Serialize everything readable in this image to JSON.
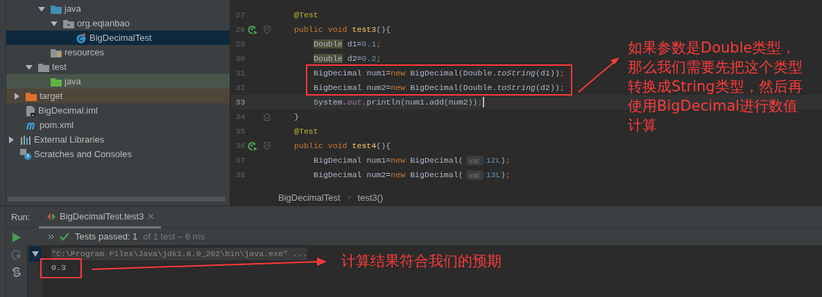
{
  "project_tree": {
    "items": [
      {
        "children": [
          {
            "children": [
              {
                "children": [
                  {
                    "label": "java",
                    "kind": "source-folder",
                    "expanded": true,
                    "selected": false,
                    "children": [
                      {
                        "label": "org.eqianbao",
                        "kind": "package",
                        "expanded": true,
                        "selected": false,
                        "children": [
                          {
                            "label": "BigDecimalTest",
                            "kind": "class",
                            "selected": true
                          }
                        ]
                      }
                    ]
                  },
                  {
                    "label": "resources",
                    "kind": "resources-folder",
                    "selected": false
                  }
                ]
              },
              {
                "label": "test",
                "kind": "folder",
                "expanded": true,
                "selected": false,
                "children": [
                  {
                    "label": "java",
                    "kind": "test-folder",
                    "selected": false
                  }
                ]
              }
            ]
          },
          {
            "label": "target",
            "kind": "excluded-folder",
            "expanded": false,
            "selected": false
          },
          {
            "label": "BigDecimal.iml",
            "kind": "module-file",
            "selected": false
          },
          {
            "label": "pom.xml",
            "kind": "maven",
            "selected": false
          }
        ]
      },
      {
        "label": "External Libraries",
        "kind": "libraries",
        "expanded": false,
        "selected": false
      },
      {
        "label": "Scratches and Consoles",
        "kind": "scratches",
        "selected": false
      }
    ]
  },
  "editor": {
    "lines": [
      {
        "number": "27",
        "kind": "member",
        "current": false,
        "runnable": false,
        "fold_start": false,
        "fold_end": false,
        "tokens": [
          {
            "kind": "annotation",
            "text": "@Test"
          }
        ]
      },
      {
        "number": "28",
        "kind": "member",
        "current": false,
        "runnable": true,
        "fold_start": true,
        "fold_end": false,
        "tokens": [
          {
            "kind": "keyword",
            "text": "public void "
          },
          {
            "kind": "method",
            "text": "test3"
          },
          {
            "kind": "plain",
            "text": "(){"
          }
        ]
      },
      {
        "number": "29",
        "kind": "statement",
        "current": false,
        "runnable": false,
        "fold_start": false,
        "fold_end": false,
        "tokens": [
          {
            "kind": "warning",
            "text": "Double"
          },
          {
            "kind": "plain",
            "text": " d1="
          },
          {
            "kind": "number",
            "text": "0.1"
          },
          {
            "kind": "keyword",
            "text": ";"
          }
        ]
      },
      {
        "number": "30",
        "kind": "statement",
        "current": false,
        "runnable": false,
        "fold_start": false,
        "fold_end": false,
        "tokens": [
          {
            "kind": "warning",
            "text": "Double"
          },
          {
            "kind": "plain",
            "text": " d2="
          },
          {
            "kind": "number",
            "text": "0.2"
          },
          {
            "kind": "keyword",
            "text": ";"
          }
        ]
      },
      {
        "number": "31",
        "kind": "statement",
        "current": false,
        "runnable": false,
        "fold_start": false,
        "fold_end": false,
        "tokens": [
          {
            "kind": "plain",
            "text": "BigDecimal num1="
          },
          {
            "kind": "keyword",
            "text": "new"
          },
          {
            "kind": "plain",
            "text": " BigDecimal(Double."
          },
          {
            "kind": "static",
            "text": "toString"
          },
          {
            "kind": "plain",
            "text": "(d1))"
          },
          {
            "kind": "keyword",
            "text": ";"
          }
        ]
      },
      {
        "number": "32",
        "kind": "statement",
        "current": false,
        "runnable": false,
        "fold_start": false,
        "fold_end": false,
        "tokens": [
          {
            "kind": "plain",
            "text": "BigDecimal num2="
          },
          {
            "kind": "keyword",
            "text": "new"
          },
          {
            "kind": "plain",
            "text": " BigDecimal(Double."
          },
          {
            "kind": "static",
            "text": "toString"
          },
          {
            "kind": "plain",
            "text": "(d2))"
          },
          {
            "kind": "keyword",
            "text": ";"
          }
        ]
      },
      {
        "number": "33",
        "kind": "statement",
        "current": true,
        "runnable": false,
        "fold_start": false,
        "fold_end": false,
        "tokens": [
          {
            "kind": "plain",
            "text": "System."
          },
          {
            "kind": "field",
            "text": "out"
          },
          {
            "kind": "plain",
            "text": ".println(num1.add(num2))"
          },
          {
            "kind": "keyword",
            "text": ";"
          }
        ]
      },
      {
        "number": "34",
        "kind": "member",
        "current": false,
        "runnable": false,
        "fold_start": false,
        "fold_end": true,
        "tokens": [
          {
            "kind": "plain",
            "text": "}"
          }
        ]
      },
      {
        "number": "35",
        "kind": "member",
        "current": false,
        "runnable": false,
        "fold_start": false,
        "fold_end": false,
        "tokens": [
          {
            "kind": "annotation",
            "text": "@Test"
          }
        ]
      },
      {
        "number": "36",
        "kind": "member",
        "current": false,
        "runnable": true,
        "fold_start": true,
        "fold_end": false,
        "tokens": [
          {
            "kind": "keyword",
            "text": "public void "
          },
          {
            "kind": "method",
            "text": "test4"
          },
          {
            "kind": "plain",
            "text": "(){"
          }
        ]
      },
      {
        "number": "37",
        "kind": "statement",
        "current": false,
        "runnable": false,
        "fold_start": false,
        "fold_end": false,
        "tokens": [
          {
            "kind": "plain",
            "text": "BigDecimal num1="
          },
          {
            "kind": "keyword",
            "text": "new"
          },
          {
            "kind": "plain",
            "text": " BigDecimal("
          },
          {
            "kind": "hint",
            "text": "val:"
          },
          {
            "kind": "number",
            "text": "12L"
          },
          {
            "kind": "plain",
            "text": ")"
          },
          {
            "kind": "keyword",
            "text": ";"
          }
        ]
      },
      {
        "number": "38",
        "kind": "statement",
        "current": false,
        "runnable": false,
        "fold_start": false,
        "fold_end": false,
        "tokens": [
          {
            "kind": "plain",
            "text": "BigDecimal num2="
          },
          {
            "kind": "keyword",
            "text": "new"
          },
          {
            "kind": "plain",
            "text": " BigDecimal("
          },
          {
            "kind": "hint",
            "text": "val:"
          },
          {
            "kind": "number",
            "text": "13L"
          },
          {
            "kind": "plain",
            "text": ")"
          },
          {
            "kind": "keyword",
            "text": ";"
          }
        ]
      }
    ],
    "breadcrumbs": [
      "BigDecimalTest",
      "test3()"
    ]
  },
  "run_panel": {
    "title": "Run:",
    "tabs": [
      {
        "label": "BigDecimalTest.test3",
        "selected": true
      }
    ],
    "status": {
      "summary": "Tests passed: 1",
      "detail": "of 1 test – 6 ms"
    },
    "console": [
      {
        "kind": "command",
        "text": "\"C:\\Program Files\\Java\\jdk1.8.0_202\\bin\\java.exe\" ..."
      },
      {
        "kind": "output",
        "text": "0.3"
      }
    ]
  },
  "annotations": [
    {
      "kind": "code-callout",
      "lines": [
        "如果参数是Double类型，",
        "那么我们需要先把这个类型",
        "转换成String类型，然后再",
        "使用BigDecimal进行数值",
        "计算"
      ]
    },
    {
      "kind": "output-callout",
      "lines": [
        "计算结果符合我们的预期"
      ]
    }
  ]
}
